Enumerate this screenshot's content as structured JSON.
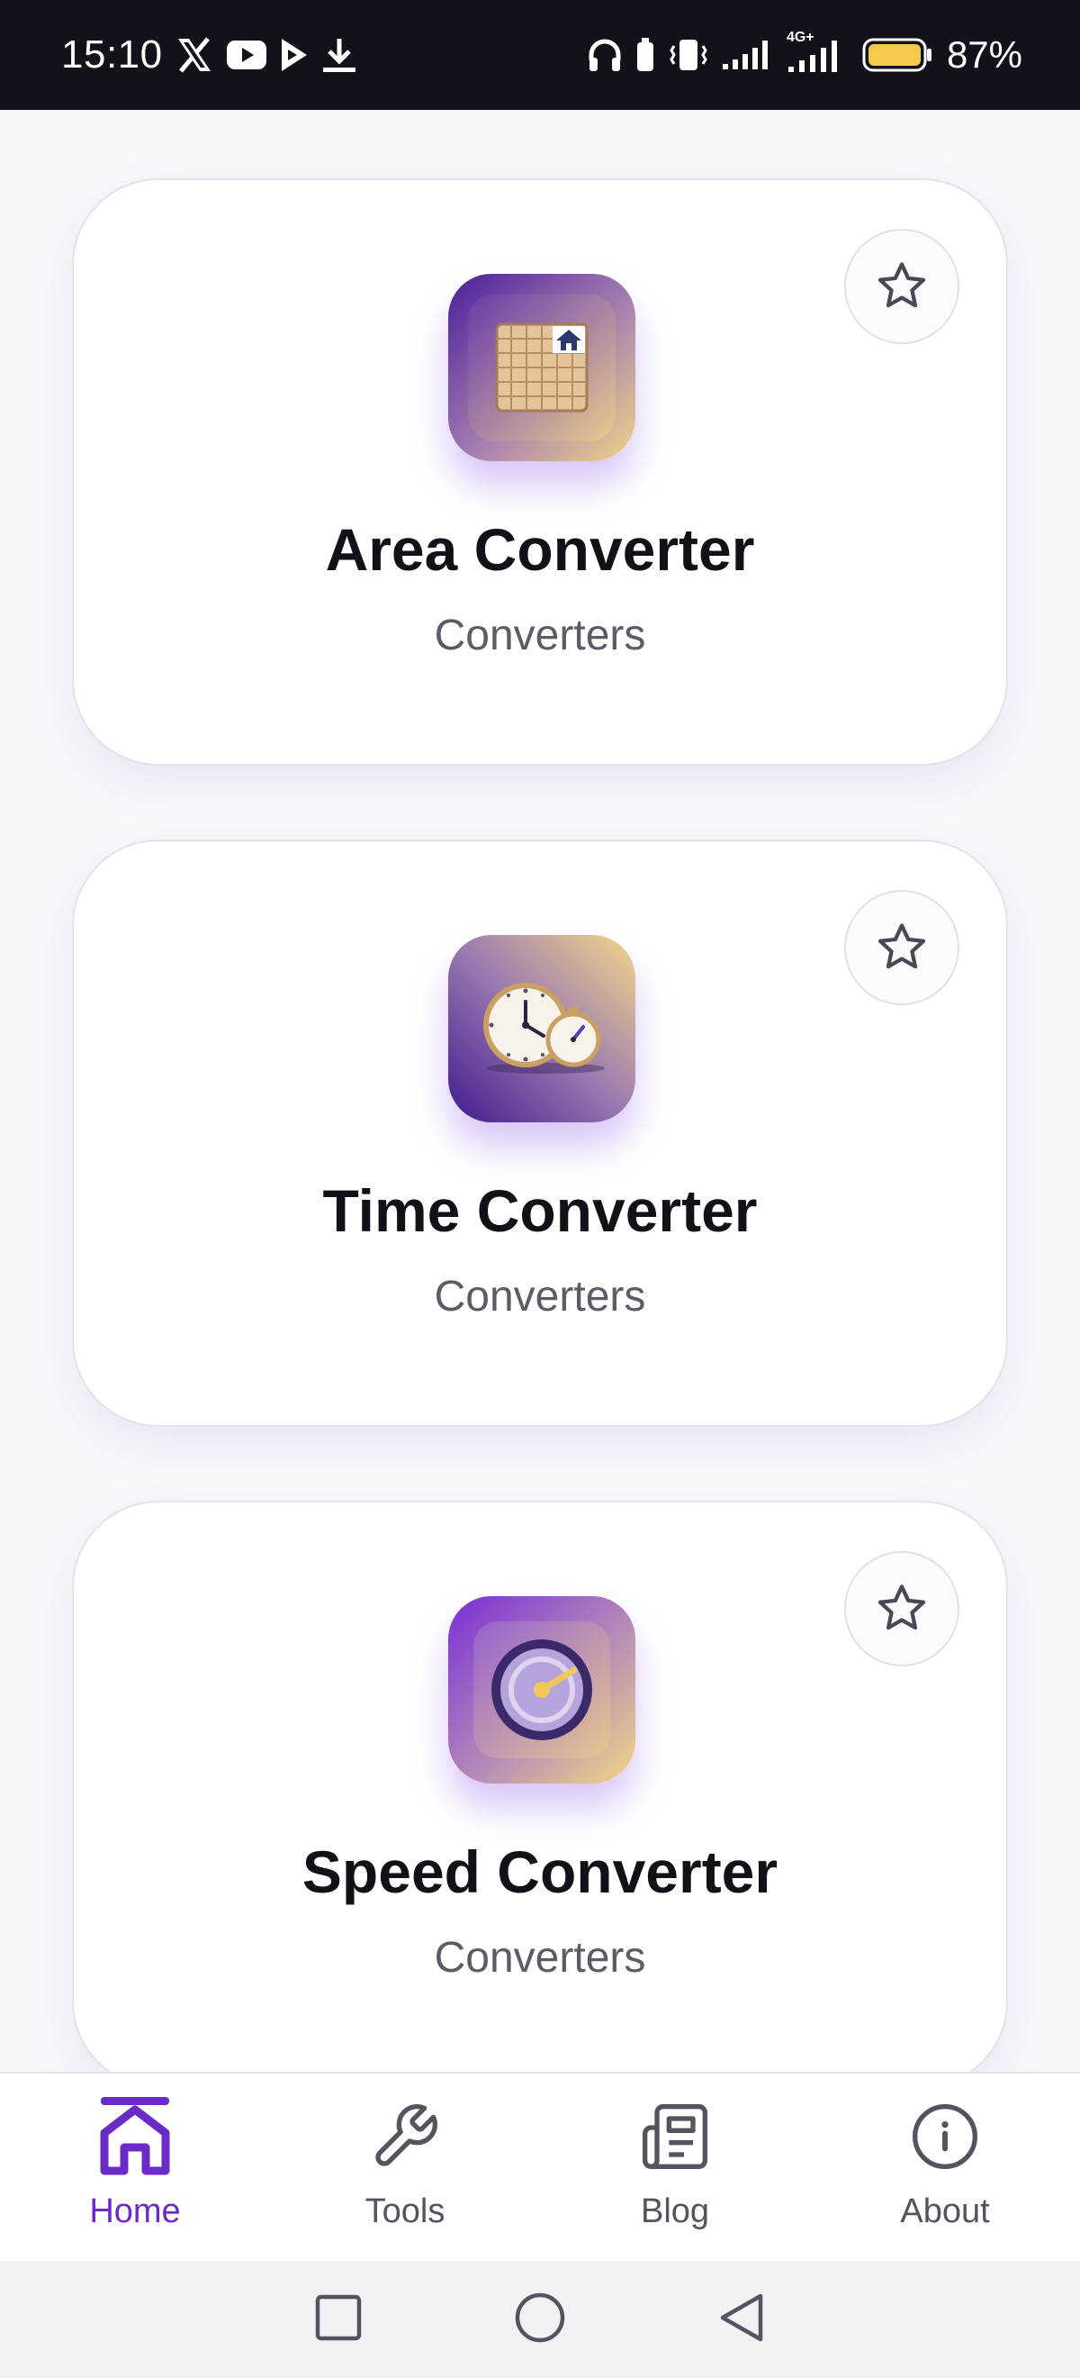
{
  "status_bar": {
    "time": "15:10",
    "battery_percent": "87%",
    "network_label": "4G+",
    "icons": [
      "x-logo-icon",
      "youtube-icon",
      "play-store-icon",
      "download-icon",
      "headphones-icon",
      "battery-saver-icon",
      "vibrate-icon",
      "signal-icon",
      "signal-4g-icon",
      "battery-icon"
    ]
  },
  "cards": [
    {
      "title": "Area Converter",
      "category": "Converters",
      "icon": "area-grid-house-icon"
    },
    {
      "title": "Time Converter",
      "category": "Converters",
      "icon": "clock-stopwatch-icon"
    },
    {
      "title": "Speed Converter",
      "category": "Converters",
      "icon": "speedometer-icon"
    }
  ],
  "bottom_nav": {
    "items": [
      {
        "label": "Home",
        "icon": "home-icon",
        "active": true
      },
      {
        "label": "Tools",
        "icon": "wrench-icon",
        "active": false
      },
      {
        "label": "Blog",
        "icon": "newspaper-icon",
        "active": false
      },
      {
        "label": "About",
        "icon": "info-icon",
        "active": false
      }
    ]
  },
  "system_nav": [
    "recents-square-icon",
    "home-circle-icon",
    "back-triangle-icon"
  ],
  "colors": {
    "accent": "#6a2bc9",
    "status_bar_bg": "#12121a",
    "page_bg": "#f8f7fa",
    "tile_purple": "#5a2aa8",
    "tile_gold": "#e9cf86"
  }
}
